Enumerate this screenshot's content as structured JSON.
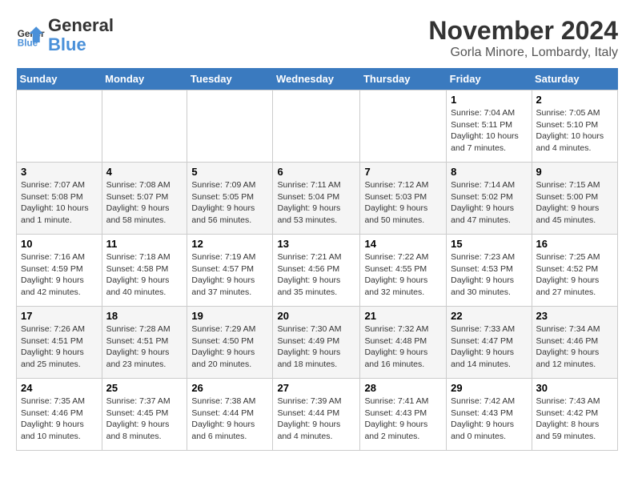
{
  "header": {
    "logo_line1": "General",
    "logo_line2": "Blue",
    "month": "November 2024",
    "location": "Gorla Minore, Lombardy, Italy"
  },
  "weekdays": [
    "Sunday",
    "Monday",
    "Tuesday",
    "Wednesday",
    "Thursday",
    "Friday",
    "Saturday"
  ],
  "weeks": [
    [
      {
        "day": "",
        "info": ""
      },
      {
        "day": "",
        "info": ""
      },
      {
        "day": "",
        "info": ""
      },
      {
        "day": "",
        "info": ""
      },
      {
        "day": "",
        "info": ""
      },
      {
        "day": "1",
        "info": "Sunrise: 7:04 AM\nSunset: 5:11 PM\nDaylight: 10 hours and 7 minutes."
      },
      {
        "day": "2",
        "info": "Sunrise: 7:05 AM\nSunset: 5:10 PM\nDaylight: 10 hours and 4 minutes."
      }
    ],
    [
      {
        "day": "3",
        "info": "Sunrise: 7:07 AM\nSunset: 5:08 PM\nDaylight: 10 hours and 1 minute."
      },
      {
        "day": "4",
        "info": "Sunrise: 7:08 AM\nSunset: 5:07 PM\nDaylight: 9 hours and 58 minutes."
      },
      {
        "day": "5",
        "info": "Sunrise: 7:09 AM\nSunset: 5:05 PM\nDaylight: 9 hours and 56 minutes."
      },
      {
        "day": "6",
        "info": "Sunrise: 7:11 AM\nSunset: 5:04 PM\nDaylight: 9 hours and 53 minutes."
      },
      {
        "day": "7",
        "info": "Sunrise: 7:12 AM\nSunset: 5:03 PM\nDaylight: 9 hours and 50 minutes."
      },
      {
        "day": "8",
        "info": "Sunrise: 7:14 AM\nSunset: 5:02 PM\nDaylight: 9 hours and 47 minutes."
      },
      {
        "day": "9",
        "info": "Sunrise: 7:15 AM\nSunset: 5:00 PM\nDaylight: 9 hours and 45 minutes."
      }
    ],
    [
      {
        "day": "10",
        "info": "Sunrise: 7:16 AM\nSunset: 4:59 PM\nDaylight: 9 hours and 42 minutes."
      },
      {
        "day": "11",
        "info": "Sunrise: 7:18 AM\nSunset: 4:58 PM\nDaylight: 9 hours and 40 minutes."
      },
      {
        "day": "12",
        "info": "Sunrise: 7:19 AM\nSunset: 4:57 PM\nDaylight: 9 hours and 37 minutes."
      },
      {
        "day": "13",
        "info": "Sunrise: 7:21 AM\nSunset: 4:56 PM\nDaylight: 9 hours and 35 minutes."
      },
      {
        "day": "14",
        "info": "Sunrise: 7:22 AM\nSunset: 4:55 PM\nDaylight: 9 hours and 32 minutes."
      },
      {
        "day": "15",
        "info": "Sunrise: 7:23 AM\nSunset: 4:53 PM\nDaylight: 9 hours and 30 minutes."
      },
      {
        "day": "16",
        "info": "Sunrise: 7:25 AM\nSunset: 4:52 PM\nDaylight: 9 hours and 27 minutes."
      }
    ],
    [
      {
        "day": "17",
        "info": "Sunrise: 7:26 AM\nSunset: 4:51 PM\nDaylight: 9 hours and 25 minutes."
      },
      {
        "day": "18",
        "info": "Sunrise: 7:28 AM\nSunset: 4:51 PM\nDaylight: 9 hours and 23 minutes."
      },
      {
        "day": "19",
        "info": "Sunrise: 7:29 AM\nSunset: 4:50 PM\nDaylight: 9 hours and 20 minutes."
      },
      {
        "day": "20",
        "info": "Sunrise: 7:30 AM\nSunset: 4:49 PM\nDaylight: 9 hours and 18 minutes."
      },
      {
        "day": "21",
        "info": "Sunrise: 7:32 AM\nSunset: 4:48 PM\nDaylight: 9 hours and 16 minutes."
      },
      {
        "day": "22",
        "info": "Sunrise: 7:33 AM\nSunset: 4:47 PM\nDaylight: 9 hours and 14 minutes."
      },
      {
        "day": "23",
        "info": "Sunrise: 7:34 AM\nSunset: 4:46 PM\nDaylight: 9 hours and 12 minutes."
      }
    ],
    [
      {
        "day": "24",
        "info": "Sunrise: 7:35 AM\nSunset: 4:46 PM\nDaylight: 9 hours and 10 minutes."
      },
      {
        "day": "25",
        "info": "Sunrise: 7:37 AM\nSunset: 4:45 PM\nDaylight: 9 hours and 8 minutes."
      },
      {
        "day": "26",
        "info": "Sunrise: 7:38 AM\nSunset: 4:44 PM\nDaylight: 9 hours and 6 minutes."
      },
      {
        "day": "27",
        "info": "Sunrise: 7:39 AM\nSunset: 4:44 PM\nDaylight: 9 hours and 4 minutes."
      },
      {
        "day": "28",
        "info": "Sunrise: 7:41 AM\nSunset: 4:43 PM\nDaylight: 9 hours and 2 minutes."
      },
      {
        "day": "29",
        "info": "Sunrise: 7:42 AM\nSunset: 4:43 PM\nDaylight: 9 hours and 0 minutes."
      },
      {
        "day": "30",
        "info": "Sunrise: 7:43 AM\nSunset: 4:42 PM\nDaylight: 8 hours and 59 minutes."
      }
    ]
  ]
}
